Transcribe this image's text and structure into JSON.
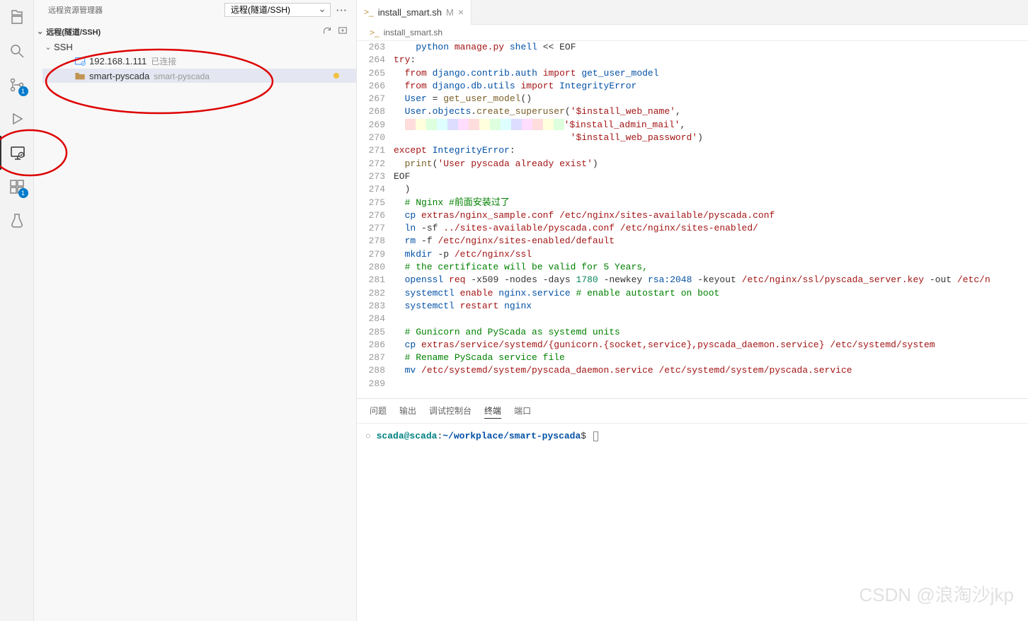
{
  "sidebar": {
    "title": "远程资源管理器",
    "select": "远程(隧道/SSH)",
    "section": "远程(隧道/SSH)",
    "ssh_label": "SSH",
    "host_ip": "192.168.1.111",
    "host_status": "已连接",
    "folder_name": "smart-pyscada",
    "folder_sub": "smart-pyscada"
  },
  "activity_badges": {
    "scm": "1",
    "extensions": "1"
  },
  "tab": {
    "filename": "install_smart.sh",
    "modified": "M"
  },
  "breadcrumb": {
    "file": "install_smart.sh"
  },
  "gutter_start": 263,
  "code_lines": [
    {
      "i": 4,
      "h": "    <span class='id'>python</span> <span class='path'>manage.py</span> <span class='id'>shell</span> &lt;&lt; EOF"
    },
    {
      "i": 0,
      "h": "<span class='kw'>try</span>:"
    },
    {
      "i": 2,
      "h": "  <span class='kw'>from</span> <span class='id'>django.contrib.auth</span> <span class='kw'>import</span> <span class='id'>get_user_model</span>"
    },
    {
      "i": 2,
      "h": "  <span class='kw'>from</span> <span class='id'>django.db.utils</span> <span class='kw'>import</span> <span class='id'>IntegrityError</span>"
    },
    {
      "i": 2,
      "h": "  <span class='id'>User</span> = <span class='fn'>get_user_model</span>()"
    },
    {
      "i": 2,
      "h": "  <span class='id'>User</span>.<span class='id'>objects</span>.<span class='fn'>create_superuser</span>(<span class='str'>'$install_web_name'</span>,"
    },
    {
      "i": 2,
      "h": "  <span class='rainbow'><span style='background:#fdd'></span><span style='background:#ffd'></span><span style='background:#dfd'></span><span style='background:#dff'></span><span style='background:#ddf'></span><span style='background:#fdf'></span><span style='background:#fdd'></span><span style='background:#ffd'></span><span style='background:#dfd'></span><span style='background:#dff'></span><span style='background:#ddf'></span><span style='background:#fdf'></span><span style='background:#fdd'></span><span style='background:#ffd'></span><span style='background:#dfd'></span></span><span class='str'>'$install_admin_mail'</span>,"
    },
    {
      "i": 32,
      "h": "                                <span class='str'>'$install_web_password'</span>)"
    },
    {
      "i": 0,
      "h": "<span class='kw'>except</span> <span class='id'>IntegrityError</span>:"
    },
    {
      "i": 2,
      "h": "  <span class='fn'>print</span>(<span class='str'>'User pyscada already exist'</span>)"
    },
    {
      "i": 0,
      "h": "EOF"
    },
    {
      "i": 2,
      "h": "  )"
    },
    {
      "i": 2,
      "h": "  <span class='cmt'># Nginx #前面安装过了</span>"
    },
    {
      "i": 2,
      "h": "  <span class='id'>cp</span> <span class='path'>extras/nginx_sample.conf</span> <span class='path'>/etc/nginx/sites-available/pyscada.conf</span>"
    },
    {
      "i": 2,
      "h": "  <span class='id'>ln</span> <span class='op'>-sf</span> <span class='path'>../sites-available/pyscada.conf</span> <span class='path'>/etc/nginx/sites-enabled/</span>"
    },
    {
      "i": 2,
      "h": "  <span class='id'>rm</span> <span class='op'>-f</span> <span class='path'>/etc/nginx/sites-enabled/default</span>"
    },
    {
      "i": 2,
      "h": "  <span class='id'>mkdir</span> <span class='op'>-p</span> <span class='path'>/etc/nginx/ssl</span>"
    },
    {
      "i": 2,
      "h": "  <span class='cmt'># the certificate will be valid for 5 Years,</span>"
    },
    {
      "i": 2,
      "h": "  <span class='id'>openssl</span> <span class='kw'>req</span> <span class='op'>-x509</span> <span class='op'>-nodes</span> <span class='op'>-days</span> <span class='num'>1780</span> <span class='op'>-newkey</span> <span class='id'>rsa:2048</span> <span class='op'>-keyout</span> <span class='path'>/etc/nginx/ssl/pyscada_server.key</span> <span class='op'>-out</span> <span class='path'>/etc/n</span>"
    },
    {
      "i": 2,
      "h": "  <span class='id'>systemctl</span> <span class='kw'>enable</span> <span class='id'>nginx.service</span> <span class='cmt'># enable autostart on boot</span>"
    },
    {
      "i": 2,
      "h": "  <span class='id'>systemctl</span> <span class='kw'>restart</span> <span class='id'>nginx</span>"
    },
    {
      "i": 0,
      "h": ""
    },
    {
      "i": 2,
      "h": "  <span class='cmt'># Gunicorn and PyScada as systemd units</span>"
    },
    {
      "i": 2,
      "h": "  <span class='id'>cp</span> <span class='path'>extras/service/systemd/{gunicorn.{socket,service},pyscada_daemon.service}</span> <span class='path'>/etc/systemd/system</span>"
    },
    {
      "i": 2,
      "h": "  <span class='cmt'># Rename PyScada service file</span>"
    },
    {
      "i": 2,
      "h": "  <span class='id'>mv</span> <span class='path'>/etc/systemd/system/pyscada_daemon.service</span> <span class='path'>/etc/systemd/system/pyscada.service</span>"
    },
    {
      "i": 0,
      "h": ""
    }
  ],
  "panel": {
    "tabs": [
      "问题",
      "输出",
      "调试控制台",
      "终端",
      "端口"
    ],
    "active": 3,
    "prompt_host": "scada@scada",
    "prompt_cwd": "~/workplace/smart-pyscada",
    "prompt_symbol": "$"
  },
  "watermark": "CSDN @浪淘沙jkp"
}
